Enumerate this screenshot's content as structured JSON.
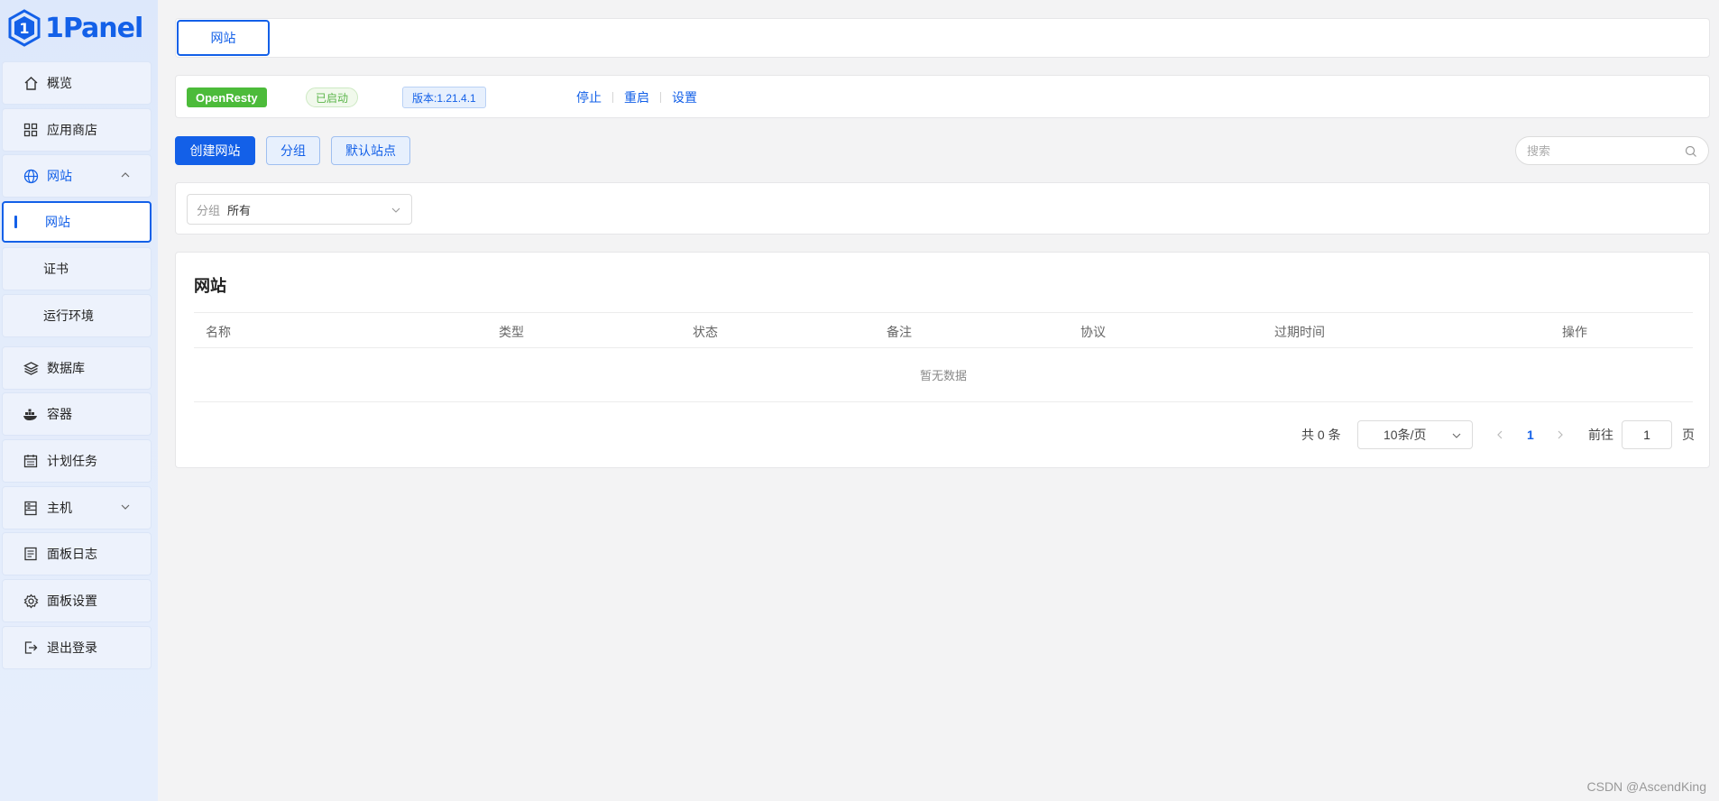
{
  "app": {
    "logo_text": "1Panel",
    "accent": "#1360e8"
  },
  "sidebar": {
    "items": [
      {
        "label": "概览",
        "icon": "home-icon"
      },
      {
        "label": "应用商店",
        "icon": "grid-icon"
      },
      {
        "label": "网站",
        "icon": "globe-icon",
        "expanded": true
      },
      {
        "label": "数据库",
        "icon": "layers-icon"
      },
      {
        "label": "容器",
        "icon": "docker-icon"
      },
      {
        "label": "计划任务",
        "icon": "calendar-icon"
      },
      {
        "label": "主机",
        "icon": "server-icon",
        "expandable": true
      },
      {
        "label": "面板日志",
        "icon": "log-icon"
      },
      {
        "label": "面板设置",
        "icon": "gear-icon"
      },
      {
        "label": "退出登录",
        "icon": "logout-icon"
      }
    ],
    "sub_items": [
      {
        "label": "网站",
        "active": true
      },
      {
        "label": "证书"
      },
      {
        "label": "运行环境"
      }
    ]
  },
  "tabs": [
    {
      "label": "网站"
    }
  ],
  "status": {
    "app_name": "OpenResty",
    "state": "已启动",
    "version": "版本:1.21.4.1",
    "actions": [
      "停止",
      "重启",
      "设置"
    ]
  },
  "toolbar": {
    "create": "创建网站",
    "group": "分组",
    "default_site": "默认站点",
    "search_placeholder": "搜索"
  },
  "filter": {
    "label": "分组",
    "value": "所有"
  },
  "table": {
    "title": "网站",
    "columns": [
      "名称",
      "类型",
      "状态",
      "备注",
      "协议",
      "过期时间",
      "操作"
    ],
    "empty_text": "暂无数据"
  },
  "pagination": {
    "total": "共 0 条",
    "page_size": "10条/页",
    "current_page": "1",
    "goto_label": "前往",
    "goto_value": "1",
    "page_suffix": "页"
  },
  "watermark": "CSDN @AscendKing"
}
